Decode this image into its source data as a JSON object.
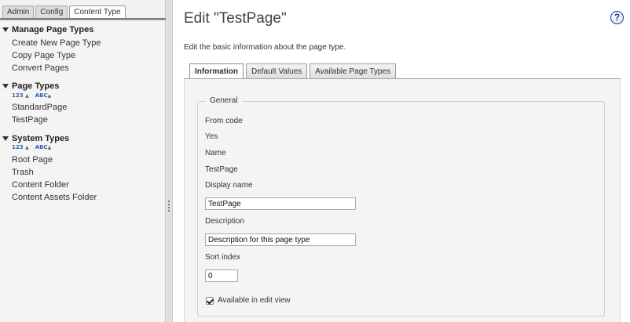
{
  "nav": {
    "tabs": [
      "Admin",
      "Config",
      "Content Type"
    ],
    "active_tab": "Content Type",
    "sections": [
      {
        "title": "Manage Page Types",
        "sorter": null,
        "items": [
          "Create New Page Type",
          "Copy Page Type",
          "Convert Pages"
        ]
      },
      {
        "title": "Page Types",
        "sorter": [
          "123",
          "ABC"
        ],
        "items": [
          "StandardPage",
          "TestPage"
        ]
      },
      {
        "title": "System Types",
        "sorter": [
          "123",
          "ABC"
        ],
        "items": [
          "Root Page",
          "Trash",
          "Content Folder",
          "Content Assets Folder"
        ]
      }
    ]
  },
  "main": {
    "title": "Edit \"TestPage\"",
    "help_glyph": "?",
    "intro": "Edit the basic information about the page type.",
    "tabs": [
      "Information",
      "Default Values",
      "Available Page Types"
    ],
    "active_tab": "Information",
    "fieldset": {
      "legend": "General",
      "from_code_label": "From code",
      "from_code_value": "Yes",
      "name_label": "Name",
      "name_value": "TestPage",
      "display_name_label": "Display name",
      "display_name_value": "TestPage",
      "description_label": "Description",
      "description_value": "Description for this page type",
      "sort_index_label": "Sort index",
      "sort_index_value": "0",
      "available_label": "Available in edit view",
      "available_checked": true
    }
  },
  "icons": {
    "collapse": "triangle-down-icon",
    "help": "help-icon",
    "sort": "sort-arrow-icon"
  }
}
